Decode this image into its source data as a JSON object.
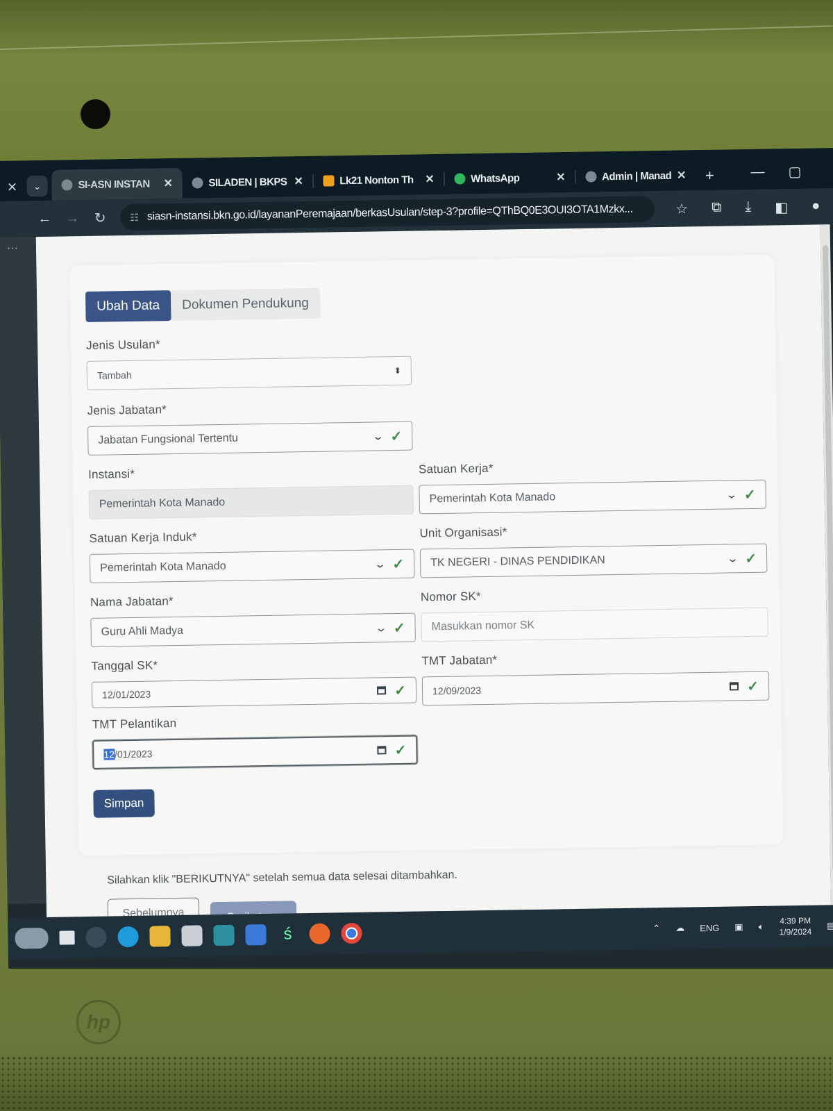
{
  "browser": {
    "tabs": [
      {
        "label": "SI-ASN INSTAN",
        "active": true
      },
      {
        "label": "SILADEN | BKPS",
        "active": false
      },
      {
        "label": "Lk21 Nonton Th",
        "active": false
      },
      {
        "label": "WhatsApp",
        "active": false
      },
      {
        "label": "Admin | Manad",
        "active": false
      }
    ],
    "url": "siasn-instansi.bkn.go.id/layananPeremajaan/berkasUsulan/step-3?profile=QThBQ0E3OUI3OTA1Mzkx..."
  },
  "form": {
    "tabs": {
      "ubah_data": "Ubah Data",
      "dokumen_pendukung": "Dokumen Pendukung"
    },
    "jenis_usulan": {
      "label": "Jenis Usulan*",
      "value": "Tambah"
    },
    "jenis_jabatan": {
      "label": "Jenis Jabatan*",
      "value": "Jabatan Fungsional Tertentu"
    },
    "instansi": {
      "label": "Instansi*",
      "value": "Pemerintah Kota Manado"
    },
    "satuan_kerja": {
      "label": "Satuan Kerja*",
      "value": "Pemerintah Kota Manado"
    },
    "satuan_kerja_induk": {
      "label": "Satuan Kerja Induk*",
      "value": "Pemerintah Kota Manado"
    },
    "unit_organisasi": {
      "label": "Unit Organisasi*",
      "value": "TK NEGERI - DINAS PENDIDIKAN"
    },
    "nama_jabatan": {
      "label": "Nama Jabatan*",
      "value": "Guru Ahli Madya"
    },
    "nomor_sk": {
      "label": "Nomor SK*",
      "placeholder": "Masukkan nomor SK"
    },
    "tanggal_sk": {
      "label": "Tanggal SK*",
      "value": "12/01/2023"
    },
    "tmt_jabatan": {
      "label": "TMT Jabatan*",
      "value": "12/09/2023"
    },
    "tmt_pelantikan": {
      "label": "TMT Pelantikan",
      "value_selected": "12",
      "value_rest": "/01/2023"
    },
    "simpan": "Simpan"
  },
  "footer": {
    "note": "Silahkan klik \"BERIKUTNYA\" setelah semua data selesai ditambahkan.",
    "sebelumnya": "Sebelumnya",
    "berikutnya": "Berikutnya"
  },
  "taskbar": {
    "lang": "ENG",
    "time": "4:39 PM",
    "date": "1/9/2024"
  }
}
